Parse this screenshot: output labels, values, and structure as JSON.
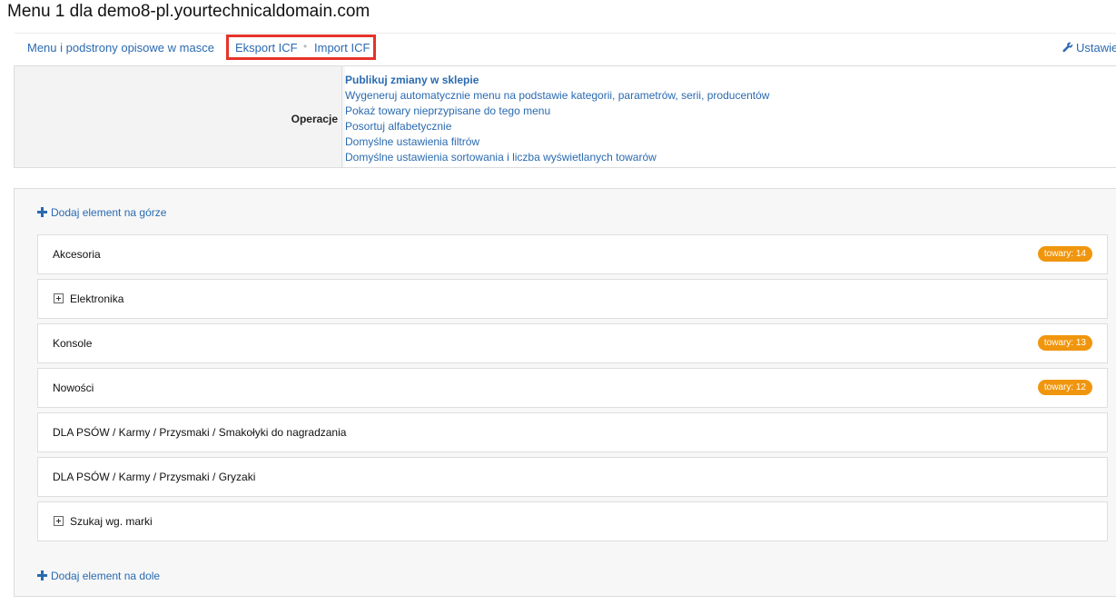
{
  "page": {
    "title": "Menu 1 dla demo8-pl.yourtechnicaldomain.com"
  },
  "topnav": {
    "bulk_label": "Menu i podstrony opisowe w masce",
    "separator": "•",
    "export_label": "Eksport ICF",
    "import_label": "Import ICF",
    "settings_label": "Ustawienia",
    "settings_icon": "wrench-icon"
  },
  "operations": {
    "label": "Operacje",
    "items": [
      {
        "label": "Publikuj zmiany w sklepie",
        "bold": true
      },
      {
        "label": "Wygeneruj automatycznie menu na podstawie kategorii, parametrów, serii, producentów",
        "bold": false
      },
      {
        "label": "Pokaż towary nieprzypisane do tego menu",
        "bold": false
      },
      {
        "label": "Posortuj alfabetycznie",
        "bold": false
      },
      {
        "label": "Domyślne ustawienia filtrów",
        "bold": false
      },
      {
        "label": "Domyślne ustawienia sortowania i liczba wyświetlanych towarów",
        "bold": false
      }
    ]
  },
  "tree": {
    "add_top_label": "Dodaj element na górze",
    "add_bottom_label": "Dodaj element na dole",
    "items": [
      {
        "label": "Akcesoria",
        "expandable": false,
        "badge": "towary: 14"
      },
      {
        "label": "Elektronika",
        "expandable": true,
        "badge": ""
      },
      {
        "label": "Konsole",
        "expandable": false,
        "badge": "towary: 13"
      },
      {
        "label": "Nowości",
        "expandable": false,
        "badge": "towary: 12"
      },
      {
        "label": "DLA PSÓW / Karmy / Przysmaki / Smakołyki do nagradzania",
        "expandable": false,
        "badge": ""
      },
      {
        "label": "DLA PSÓW / Karmy / Przysmaki / Gryzaki",
        "expandable": false,
        "badge": ""
      },
      {
        "label": "Szukaj wg. marki",
        "expandable": true,
        "badge": ""
      }
    ]
  },
  "colors": {
    "link": "#2a6ab0",
    "badge": "#f0960e",
    "highlight": "#e6332a"
  }
}
